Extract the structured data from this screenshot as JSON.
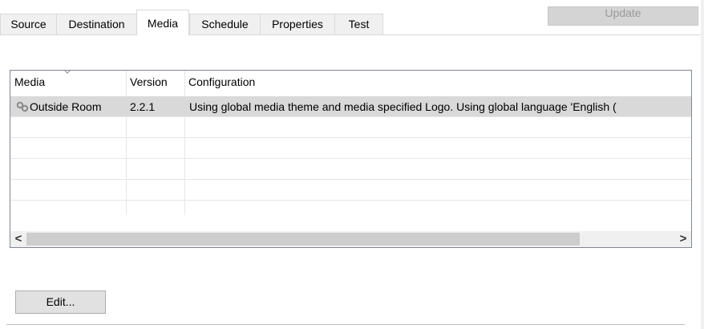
{
  "tabs": [
    {
      "label": "Source"
    },
    {
      "label": "Destination"
    },
    {
      "label": "Media",
      "active": true
    },
    {
      "label": "Schedule"
    },
    {
      "label": "Properties"
    },
    {
      "label": "Test"
    }
  ],
  "update_button": {
    "label": "Update",
    "enabled": false
  },
  "grid": {
    "columns": [
      {
        "label": "Media",
        "sorted": "descending"
      },
      {
        "label": "Version"
      },
      {
        "label": "Configuration"
      }
    ],
    "rows": [
      {
        "media": "Outside Room",
        "version": "2.2.1",
        "configuration": "Using global media theme and media specified Logo. Using global language 'English (",
        "icon": "media-link-icon",
        "selected": true
      }
    ],
    "empty_rows": 5
  },
  "scrollbar": {
    "left_arrow": "<",
    "right_arrow": ">"
  },
  "edit_button": {
    "label": "Edit..."
  },
  "colors": {
    "accent": "#d9d9d9",
    "border": "#828790",
    "disabled_text": "#9a9a9a"
  }
}
